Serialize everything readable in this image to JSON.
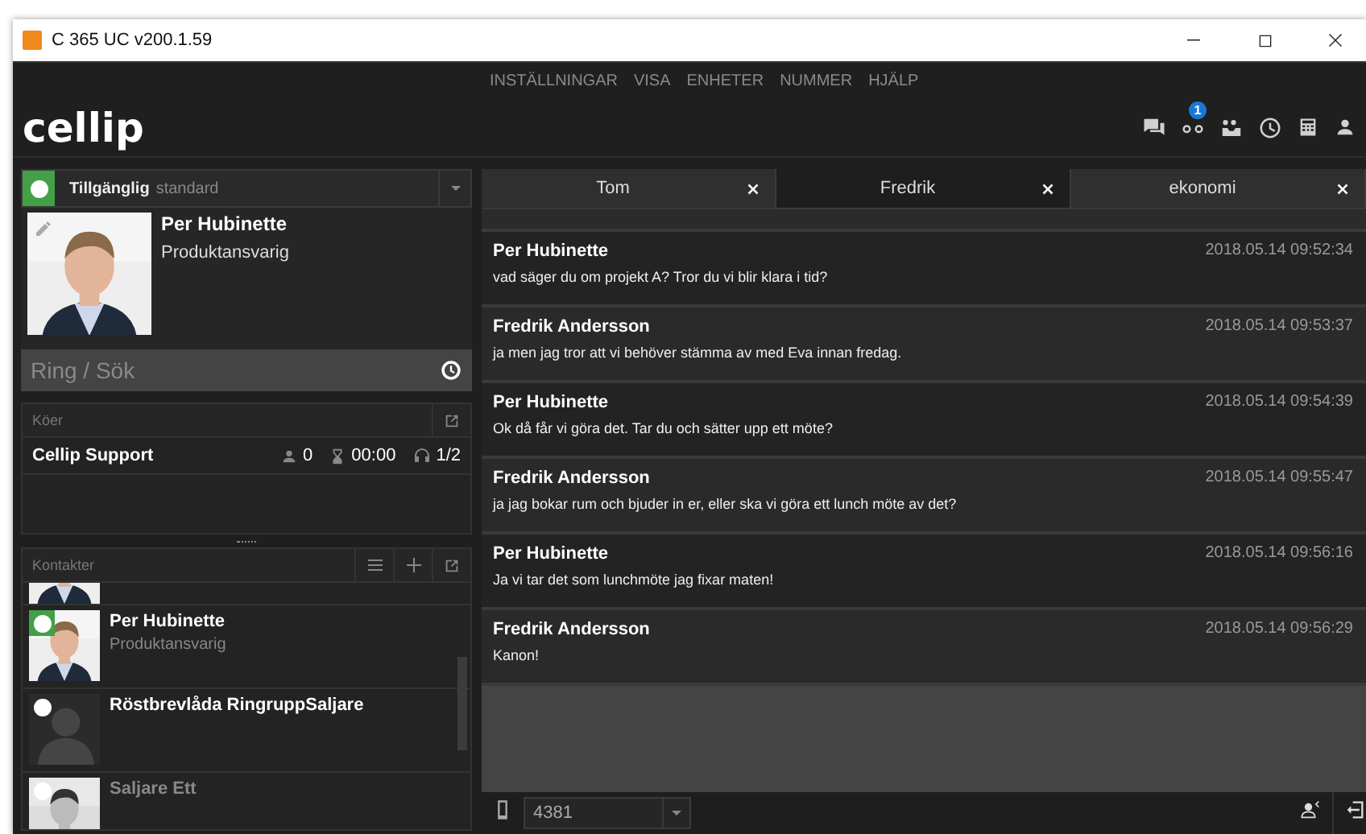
{
  "window": {
    "title": "C 365 UC v200.1.59"
  },
  "menu": [
    "INSTÄLLNINGAR",
    "VISA",
    "ENHETER",
    "NUMMER",
    "HJÄLP"
  ],
  "logo": "cellip",
  "toolbar": {
    "voicemail_badge": "1"
  },
  "presence": {
    "status": "Tillgänglig",
    "profile": "standard",
    "available": true
  },
  "profile": {
    "name": "Per Hubinette",
    "title": "Produktansvarig"
  },
  "search": {
    "placeholder": "Ring / Sök"
  },
  "queues": {
    "title": "Köer",
    "rows": [
      {
        "name": "Cellip Support",
        "waiting": "0",
        "wait_time": "00:00",
        "agents": "1/2"
      }
    ]
  },
  "contacts": {
    "title": "Kontakter",
    "items": [
      {
        "name": "Per Hubinette",
        "title": "Produktansvarig",
        "available": true,
        "offline": false
      },
      {
        "name": "Röstbrevlåda RingruppSaljare",
        "available": false,
        "offline": false,
        "kind": "silhouette"
      },
      {
        "name": "Saljare Ett",
        "available": false,
        "offline": true
      }
    ]
  },
  "tabs": [
    {
      "label": "Tom",
      "selected": false
    },
    {
      "label": "Fredrik",
      "selected": true
    },
    {
      "label": "ekonomi",
      "selected": false
    }
  ],
  "messages": [
    {
      "sender": "Per Hubinette",
      "time": "2018.05.14 09:52:34",
      "text": "vad säger du om projekt A? Tror du vi blir klara i tid?"
    },
    {
      "sender": "Fredrik Andersson",
      "time": "2018.05.14 09:53:37",
      "text": "ja men jag tror att vi behöver stämma av med Eva innan fredag."
    },
    {
      "sender": "Per Hubinette",
      "time": "2018.05.14 09:54:39",
      "text": "Ok då får vi göra det. Tar du och sätter upp ett möte?"
    },
    {
      "sender": "Fredrik Andersson",
      "time": "2018.05.14 09:55:47",
      "text": "ja jag bokar rum och bjuder in er, eller ska vi göra ett lunch möte av det?"
    },
    {
      "sender": "Per Hubinette",
      "time": "2018.05.14 09:56:16",
      "text": "Ja vi tar det som lunchmöte jag fixar maten!"
    },
    {
      "sender": "Fredrik Andersson",
      "time": "2018.05.14 09:56:29",
      "text": "Kanon!"
    }
  ],
  "bottom_bar": {
    "line": "4381"
  }
}
